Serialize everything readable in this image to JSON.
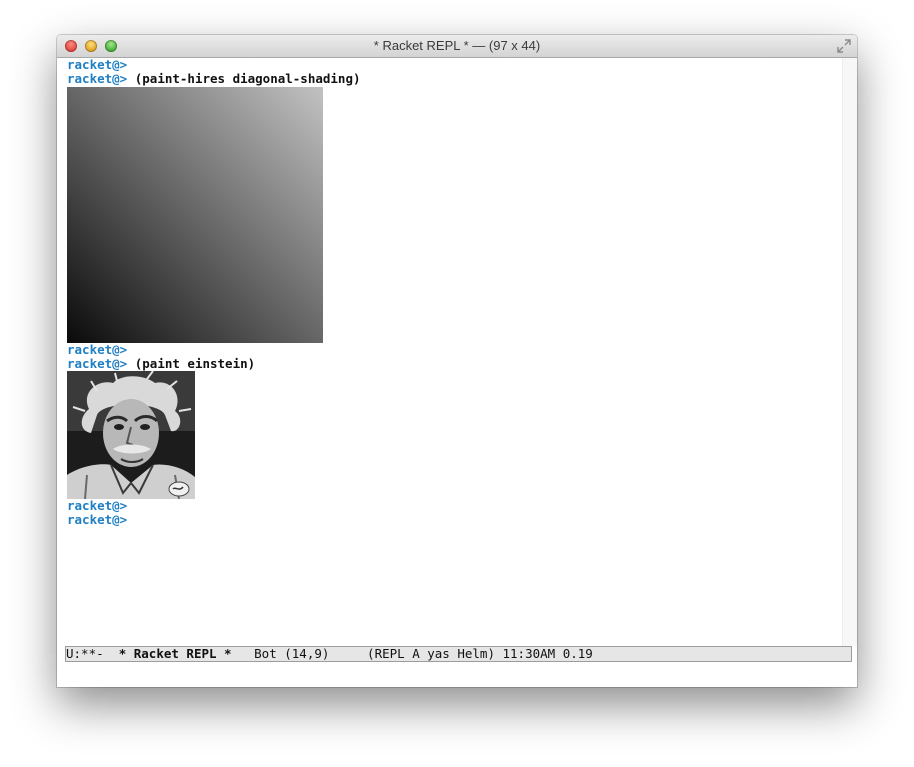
{
  "window": {
    "title": "* Racket REPL *  —  (97 x 44)"
  },
  "repl": {
    "prompt": "racket@>",
    "lines": [
      {
        "prompt": "racket@>",
        "command": ""
      },
      {
        "prompt": "racket@>",
        "command": " (paint-hires diagonal-shading)"
      },
      {
        "prompt": "racket@>",
        "command": ""
      },
      {
        "prompt": "racket@>",
        "command": " (paint einstein)"
      },
      {
        "prompt": "racket@>",
        "command": ""
      },
      {
        "prompt": "racket@>",
        "command": ""
      }
    ]
  },
  "images": {
    "shading": "diagonal-shading-image",
    "einstein": "einstein-photo-image"
  },
  "modeline": {
    "status": "U:**-  ",
    "buffer": "* Racket REPL *",
    "position": "   Bot (14,9)     ",
    "modes": "(REPL A yas Helm) 11:30AM 0.19"
  },
  "colors": {
    "prompt": "#1f7fc4",
    "modeline_bg": "#e6e6e6"
  }
}
